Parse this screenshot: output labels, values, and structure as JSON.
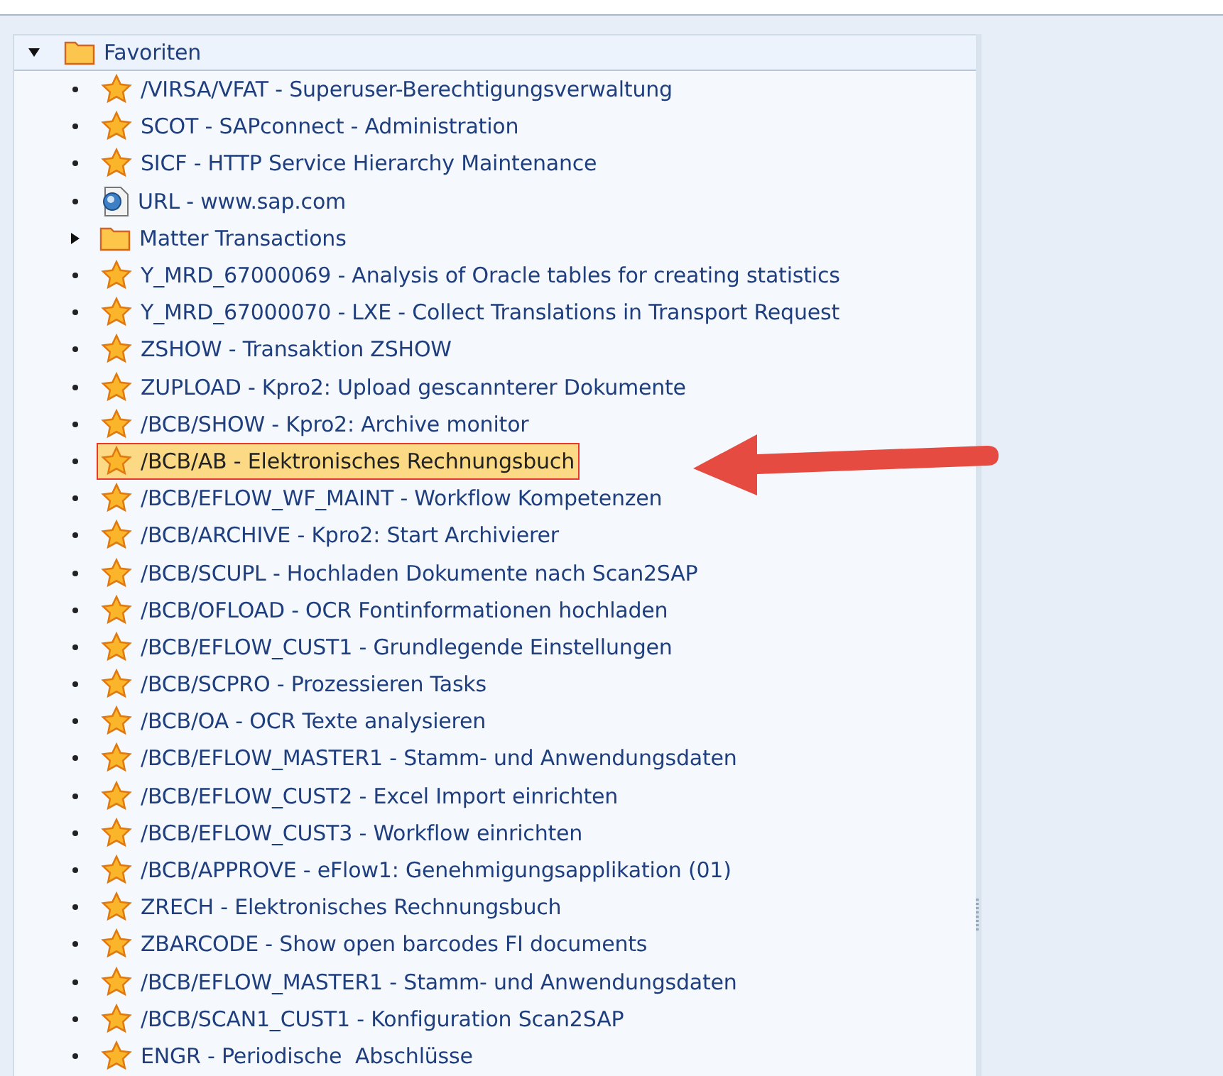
{
  "tree": {
    "root": {
      "label": "Favoriten",
      "expanded": true
    },
    "items": [
      {
        "kind": "star",
        "label": "/VIRSA/VFAT - Superuser-Berechtigungsverwaltung",
        "selected": false
      },
      {
        "kind": "star",
        "label": "SCOT - SAPconnect - Administration",
        "selected": false
      },
      {
        "kind": "star",
        "label": "SICF - HTTP Service Hierarchy Maintenance",
        "selected": false
      },
      {
        "kind": "url",
        "label": "URL - www.sap.com",
        "selected": false
      },
      {
        "kind": "folder",
        "label": "Matter Transactions",
        "selected": false,
        "expanded": false
      },
      {
        "kind": "star",
        "label": "Y_MRD_67000069 - Analysis of Oracle tables for creating statistics",
        "selected": false
      },
      {
        "kind": "star",
        "label": "Y_MRD_67000070 - LXE - Collect Translations in Transport Request",
        "selected": false
      },
      {
        "kind": "star",
        "label": "ZSHOW - Transaktion ZSHOW",
        "selected": false
      },
      {
        "kind": "star",
        "label": "ZUPLOAD - Kpro2: Upload gescannterer Dokumente",
        "selected": false
      },
      {
        "kind": "star",
        "label": "/BCB/SHOW - Kpro2: Archive monitor",
        "selected": false
      },
      {
        "kind": "star",
        "label": "/BCB/AB - Elektronisches Rechnungsbuch",
        "selected": true
      },
      {
        "kind": "star",
        "label": "/BCB/EFLOW_WF_MAINT - Workflow Kompetenzen",
        "selected": false
      },
      {
        "kind": "star",
        "label": "/BCB/ARCHIVE - Kpro2: Start Archivierer",
        "selected": false
      },
      {
        "kind": "star",
        "label": "/BCB/SCUPL - Hochladen Dokumente nach Scan2SAP",
        "selected": false
      },
      {
        "kind": "star",
        "label": "/BCB/OFLOAD - OCR Fontinformationen hochladen",
        "selected": false
      },
      {
        "kind": "star",
        "label": "/BCB/EFLOW_CUST1 - Grundlegende Einstellungen",
        "selected": false
      },
      {
        "kind": "star",
        "label": "/BCB/SCPRO - Prozessieren Tasks",
        "selected": false
      },
      {
        "kind": "star",
        "label": "/BCB/OA - OCR Texte analysieren",
        "selected": false
      },
      {
        "kind": "star",
        "label": "/BCB/EFLOW_MASTER1 - Stamm- und Anwendungsdaten",
        "selected": false
      },
      {
        "kind": "star",
        "label": "/BCB/EFLOW_CUST2 - Excel Import einrichten",
        "selected": false
      },
      {
        "kind": "star",
        "label": "/BCB/EFLOW_CUST3 - Workflow einrichten",
        "selected": false
      },
      {
        "kind": "star",
        "label": "/BCB/APPROVE - eFlow1: Genehmigungsapplikation (01)",
        "selected": false
      },
      {
        "kind": "star",
        "label": "ZRECH - Elektronisches Rechnungsbuch",
        "selected": false
      },
      {
        "kind": "star",
        "label": "ZBARCODE - Show open barcodes FI documents",
        "selected": false
      },
      {
        "kind": "star",
        "label": "/BCB/EFLOW_MASTER1 - Stamm- und Anwendungsdaten",
        "selected": false
      },
      {
        "kind": "star",
        "label": "/BCB/SCAN1_CUST1 - Konfiguration Scan2SAP",
        "selected": false
      },
      {
        "kind": "star",
        "label": "ENGR - Periodische  Abschlüsse",
        "selected": false
      }
    ]
  }
}
